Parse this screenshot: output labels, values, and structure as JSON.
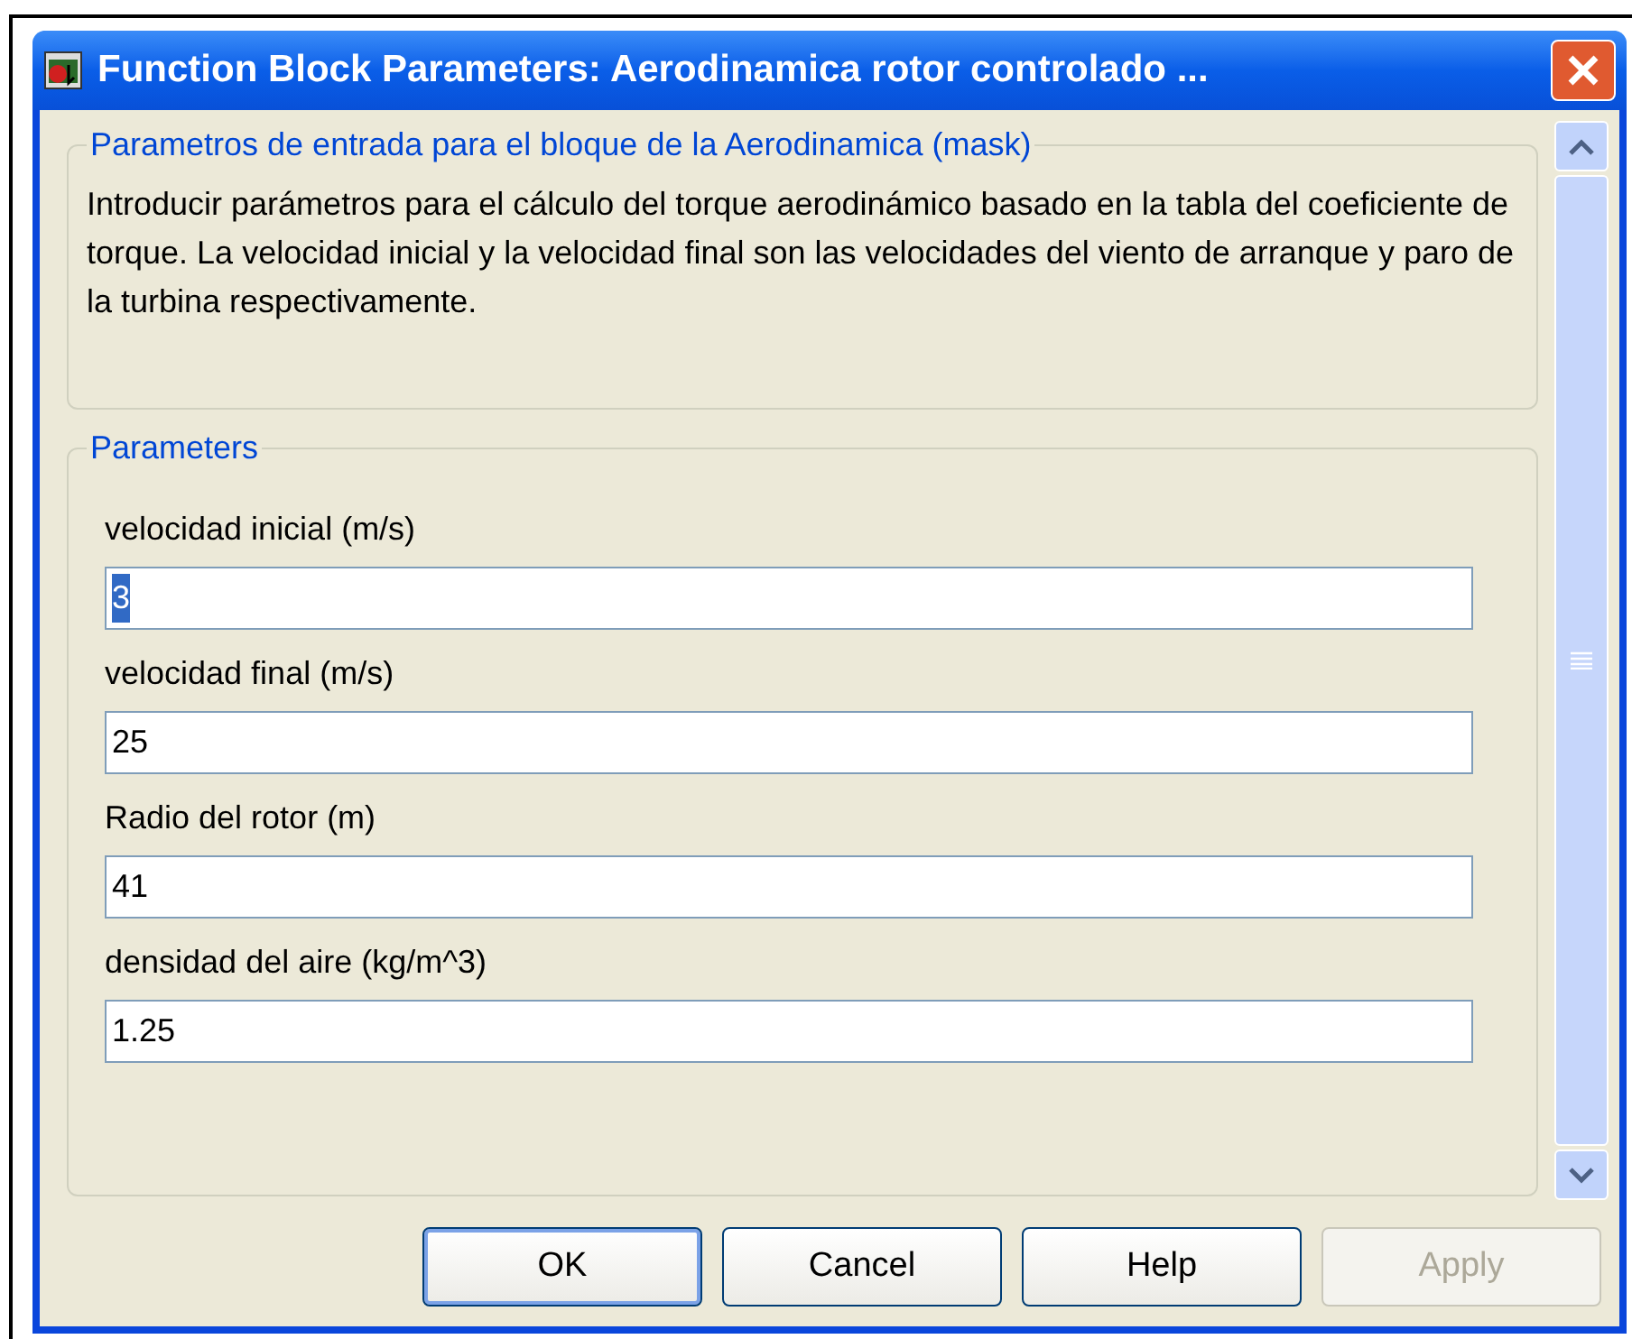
{
  "window": {
    "title": "Function Block Parameters: Aerodinamica rotor controlado ..."
  },
  "description_group": {
    "title": "Parametros de entrada para el bloque de la Aerodinamica (mask)",
    "text": "Introducir parámetros para el cálculo del torque aerodinámico basado en la tabla del coeficiente de torque. La velocidad inicial y la velocidad final son las velocidades del viento de arranque y paro de la turbina respectivamente."
  },
  "parameters_group": {
    "title": "Parameters",
    "fields": [
      {
        "label": "velocidad inicial (m/s)",
        "value": "3",
        "text_selected": true
      },
      {
        "label": "velocidad final (m/s)",
        "value": "25",
        "text_selected": false
      },
      {
        "label": "Radio del rotor (m)",
        "value": "41",
        "text_selected": false
      },
      {
        "label": "densidad del aire (kg/m^3)",
        "value": "1.25",
        "text_selected": false
      }
    ]
  },
  "buttons": [
    {
      "label": "OK",
      "disabled": false,
      "default": true
    },
    {
      "label": "Cancel",
      "disabled": false,
      "default": false
    },
    {
      "label": "Help",
      "disabled": false,
      "default": false
    },
    {
      "label": "Apply",
      "disabled": true,
      "default": false
    }
  ]
}
